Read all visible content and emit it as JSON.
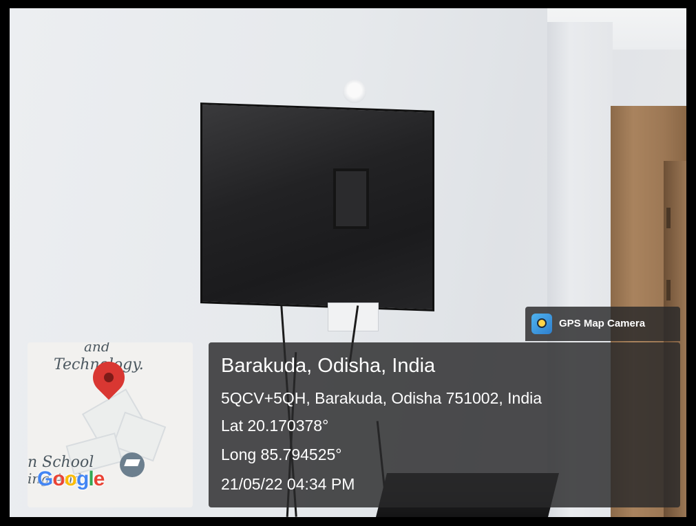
{
  "photo": {
    "description_hidden": ""
  },
  "map": {
    "label_top": "and",
    "label_technology": "Technology.",
    "label_school": "n School",
    "label_bottom": "ing And",
    "logo": {
      "letters": [
        "G",
        "o",
        "o",
        "g",
        "l",
        "e"
      ],
      "colors": [
        "#4285F4",
        "#EA4335",
        "#FBBC05",
        "#4285F4",
        "#34A853",
        "#EA4335"
      ]
    },
    "pin_icon": "map-pin-icon",
    "school_icon": "graduation-cap-icon"
  },
  "badge": {
    "label": "GPS Map Camera",
    "icon": "gps-map-camera-app-icon"
  },
  "location": {
    "title": "Barakuda, Odisha, India",
    "address": "5QCV+5QH, Barakuda, Odisha 751002, India",
    "lat": "Lat 20.170378°",
    "long": "Long 85.794525°",
    "datetime": "21/05/22 04:34 PM"
  }
}
